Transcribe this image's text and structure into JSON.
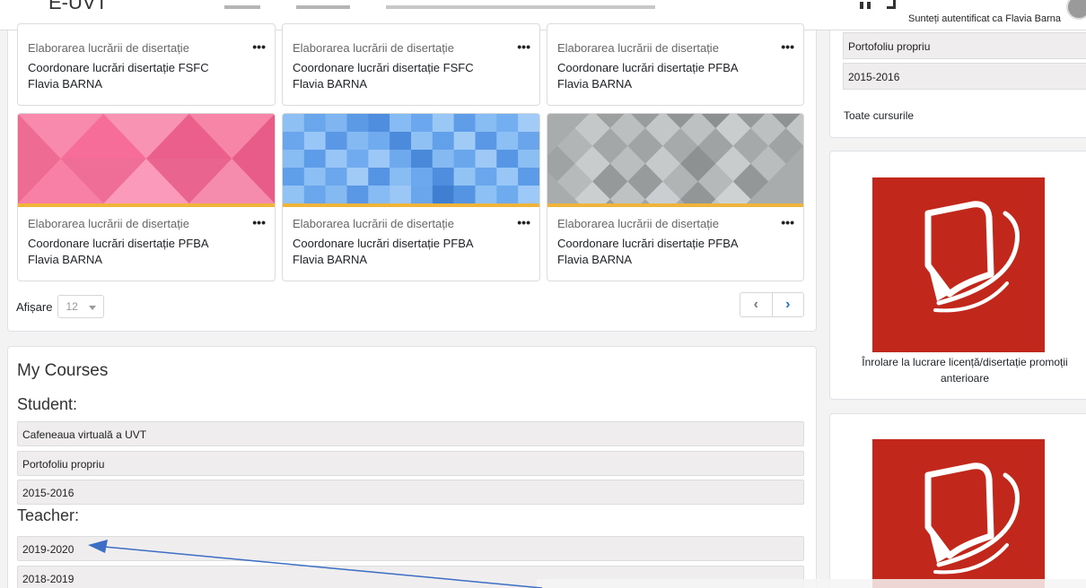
{
  "header": {
    "brand": "E-UVT",
    "auth_text": "Sunteți autentificat ca Flavia Barna"
  },
  "courses_overview": {
    "cards": [
      {
        "category": "Elaborarea lucrării de disertație",
        "name": "Coordonare lucrări disertație FSFC",
        "teacher": "Flavia BARNA",
        "menu": "•••"
      },
      {
        "category": "Elaborarea lucrării de disertație",
        "name": "Coordonare lucrări disertație FSFC",
        "teacher": "Flavia BARNA",
        "menu": "•••"
      },
      {
        "category": "Elaborarea lucrării de disertație",
        "name": "Coordonare lucrări disertație PFBA",
        "teacher": "Flavia BARNA",
        "menu": "•••"
      },
      {
        "category": "Elaborarea lucrării de disertație",
        "name": "Coordonare lucrări disertație PFBA",
        "teacher": "Flavia BARNA",
        "menu": "•••",
        "pattern": "pink-triangles"
      },
      {
        "category": "Elaborarea lucrării de disertație",
        "name": "Coordonare lucrări disertație PFBA",
        "teacher": "Flavia BARNA",
        "menu": "•••",
        "pattern": "blue-squares"
      },
      {
        "category": "Elaborarea lucrării de disertație",
        "name": "Coordonare lucrări disertație PFBA",
        "teacher": "Flavia BARNA",
        "menu": "•••",
        "pattern": "grey-diamonds"
      }
    ],
    "show_label": "Afișare",
    "show_value": "12",
    "pager": {
      "prev_icon": "chevron-left-icon",
      "next_icon": "chevron-right-icon"
    }
  },
  "my_courses": {
    "title": "My Courses",
    "student_label": "Student:",
    "student_items": [
      "Cafeneaua virtuală a UVT",
      "Portofoliu propriu",
      "2015-2016"
    ],
    "teacher_label": "Teacher:",
    "teacher_items": [
      "2019-2020",
      "2018-2019"
    ]
  },
  "sidebar": {
    "items": [
      "Portofoliu propriu",
      "2015-2016"
    ],
    "all_courses_link": "Toate cursurile",
    "promo_caption": "Înrolare la lucrare licență/disertație promoții anterioare"
  },
  "colors": {
    "accent": "#1a73c7",
    "card_strip": "#f0b43a",
    "promo_red": "#c1281b",
    "annotation_arrow": "#3b6ec4"
  }
}
